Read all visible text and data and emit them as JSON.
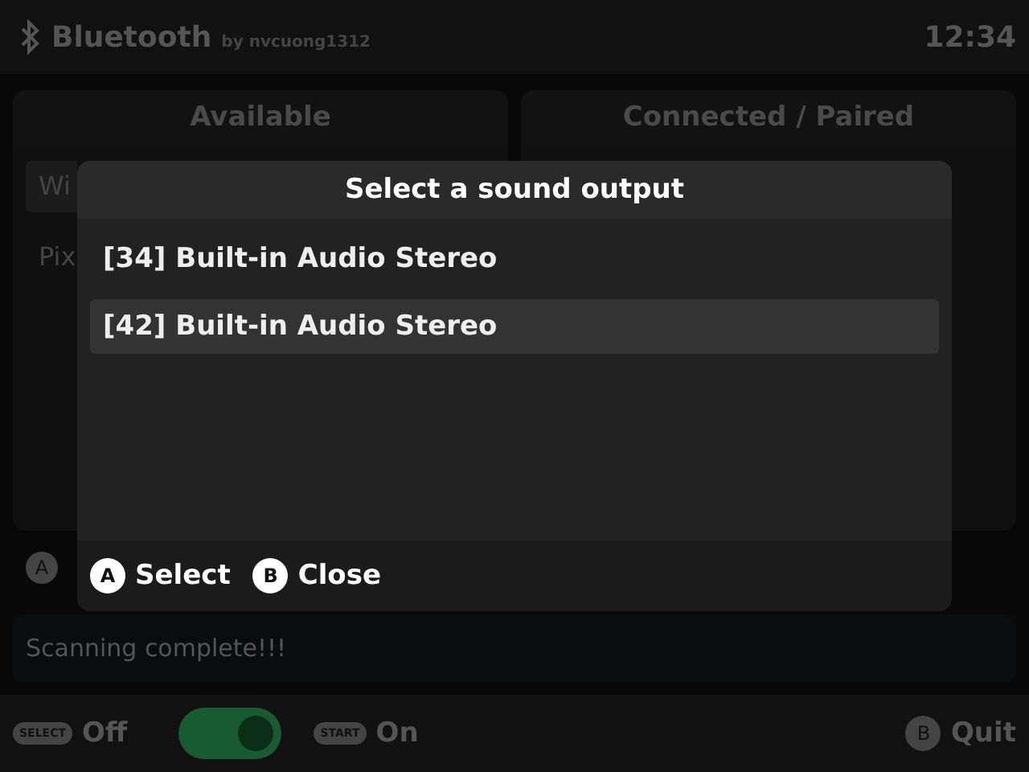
{
  "header": {
    "title": "Bluetooth",
    "byline": "by nvcuong1312",
    "time": "12:34"
  },
  "panels": [
    {
      "title": "Available",
      "items": [
        {
          "label": "Wi",
          "selected": true
        },
        {
          "label": "Pix",
          "selected": false
        }
      ]
    },
    {
      "title": "Connected / Paired"
    }
  ],
  "hint_bar": {
    "button": "A"
  },
  "status": "Scanning complete!!!",
  "footer": {
    "off_button": "SELECT",
    "off_label": "Off",
    "toggle": {
      "on": true
    },
    "on_button": "START",
    "on_label": "On",
    "quit_button": "B",
    "quit_label": "Quit"
  },
  "dialog": {
    "title": "Select a sound output",
    "items": [
      {
        "label": "[34] Built-in Audio Stereo",
        "selected": false
      },
      {
        "label": "[42] Built-in Audio Stereo",
        "selected": true
      }
    ],
    "actions": [
      {
        "button": "A",
        "label": "Select"
      },
      {
        "button": "B",
        "label": "Close"
      }
    ]
  }
}
